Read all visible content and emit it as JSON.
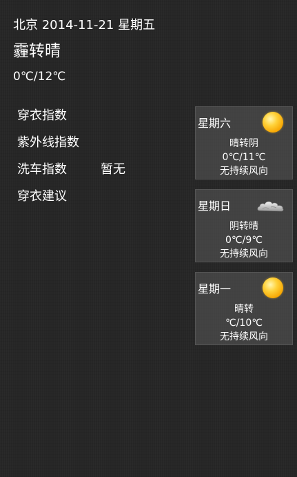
{
  "header": {
    "city": "北京",
    "date": "2014-11-21",
    "weekday": "星期五"
  },
  "today": {
    "weather": "霾转晴",
    "temperature": "0℃/12℃"
  },
  "indices": [
    {
      "label": "穿衣指数",
      "value": ""
    },
    {
      "label": "紫外线指数",
      "value": ""
    },
    {
      "label": "洗车指数",
      "value": "暂无"
    },
    {
      "label": "穿衣建议",
      "value": ""
    }
  ],
  "forecast": [
    {
      "day": "星期六",
      "icon": "sun-icon",
      "weather": "晴转阴",
      "temperature": "0℃/11℃",
      "wind": "无持续风向"
    },
    {
      "day": "星期日",
      "icon": "cloud-icon",
      "weather": "阴转晴",
      "temperature": "0℃/9℃",
      "wind": "无持续风向"
    },
    {
      "day": "星期一",
      "icon": "sun-icon",
      "weather": "晴转",
      "temperature": "℃/10℃",
      "wind": "无持续风向"
    }
  ],
  "colors": {
    "background": "#262626",
    "text": "#ffffff",
    "card": "#5a5a5a"
  }
}
